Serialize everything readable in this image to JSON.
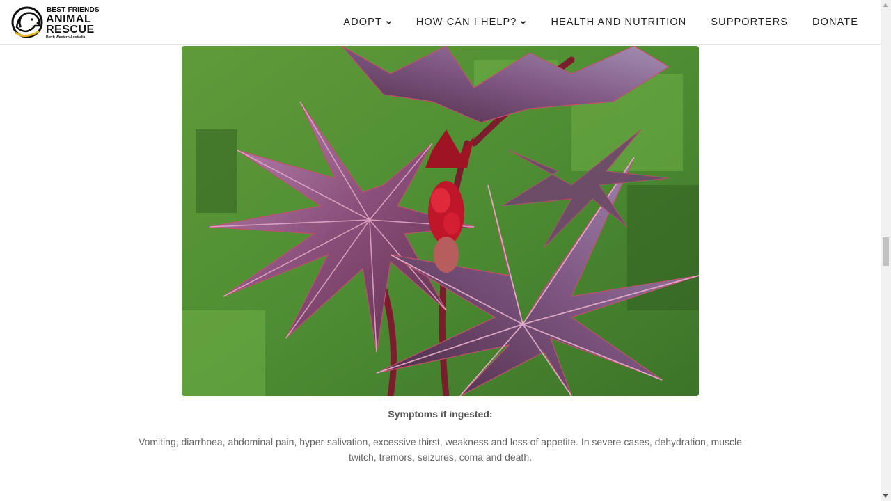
{
  "header": {
    "logo": {
      "line1": "BEST FRIENDS",
      "line2": "ANIMAL",
      "line3": "RESCUE",
      "line4": "Perth Western Australia"
    },
    "nav": [
      {
        "label": "ADOPT",
        "dropdown": true
      },
      {
        "label": "HOW CAN I HELP?",
        "dropdown": true
      },
      {
        "label": "HEALTH AND NUTRITION",
        "dropdown": false
      },
      {
        "label": "SUPPORTERS",
        "dropdown": false
      },
      {
        "label": "DONATE",
        "dropdown": false
      }
    ]
  },
  "main": {
    "image_subject": "castor bean plant with purple-red star-shaped leaves and red spiky flower cluster",
    "symptoms_title": "Symptoms if ingested:",
    "symptoms_text": "Vomiting, diarrhoea, abdominal pain, hyper-salivation, excessive thirst, weakness and loss of appetite. In severe cases, dehydration, muscle twitch, tremors, seizures, coma and death."
  },
  "colors": {
    "nav_text": "#222222",
    "body_text": "#666666",
    "leaf": "#8a4e6e",
    "grass": "#4b8a2e"
  }
}
